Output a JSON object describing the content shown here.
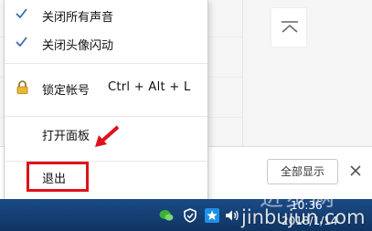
{
  "menu": {
    "items": [
      {
        "label": "关闭所有声音",
        "checked": true,
        "icon": "checkmark-icon"
      },
      {
        "label": "关闭头像闪动",
        "checked": true,
        "icon": "checkmark-icon"
      },
      {
        "label": "锁定帐号",
        "icon": "lock-icon",
        "shortcut": "Ctrl + Alt + L"
      },
      {
        "label": "打开面板"
      },
      {
        "label": "退出",
        "highlighted": true
      }
    ]
  },
  "background": {
    "show_all_label": "全部显示",
    "close_label": "✕"
  },
  "taskbar": {
    "time": "10:36",
    "date": "2018/1/14"
  },
  "watermark": {
    "text": "进步网",
    "url": "jinbujun.com"
  },
  "colors": {
    "highlight_red": "#e0101a",
    "taskbar_blue": "#1b4a86",
    "check_blue": "#3a6fb0"
  }
}
